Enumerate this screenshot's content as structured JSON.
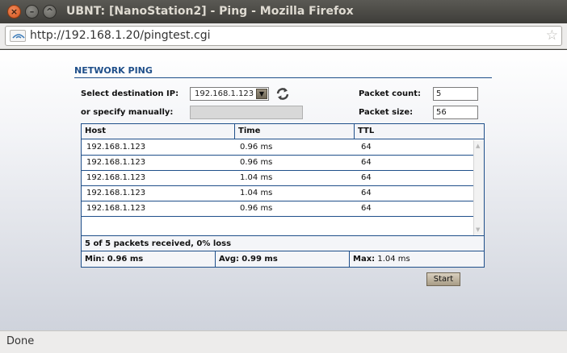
{
  "window": {
    "title": "UBNT: [NanoStation2] - Ping - Mozilla Firefox",
    "close_glyph": "×",
    "min_glyph": "–",
    "max_glyph": "^"
  },
  "urlbar": {
    "url": "http://192.168.1.20/pingtest.cgi",
    "bookmark_glyph": "☆"
  },
  "ping": {
    "section_title": "NETWORK PING",
    "dest_label": "Select destination IP:",
    "dest_value": "192.168.1.123",
    "manual_label": "or specify manually:",
    "manual_value": "",
    "count_label": "Packet count:",
    "count_value": "5",
    "size_label": "Packet size:",
    "size_value": "56",
    "columns": [
      "Host",
      "Time",
      "TTL"
    ],
    "rows": [
      {
        "host": "192.168.1.123",
        "time": "0.96 ms",
        "ttl": "64"
      },
      {
        "host": "192.168.1.123",
        "time": "0.96 ms",
        "ttl": "64"
      },
      {
        "host": "192.168.1.123",
        "time": "1.04 ms",
        "ttl": "64"
      },
      {
        "host": "192.168.1.123",
        "time": "1.04 ms",
        "ttl": "64"
      },
      {
        "host": "192.168.1.123",
        "time": "0.96 ms",
        "ttl": "64"
      }
    ],
    "summary_bold": "5 of 5 packets received, 0% loss",
    "min_label": "Min:",
    "min_value": "0.96 ms",
    "avg_label": "Avg:",
    "avg_value": "0.99 ms",
    "max_label": "Max:",
    "max_value": "1.04 ms",
    "start_label": "Start"
  },
  "status": {
    "text": "Done"
  },
  "colors": {
    "accent": "#1f4f8a",
    "close_button": "#d4531d"
  }
}
